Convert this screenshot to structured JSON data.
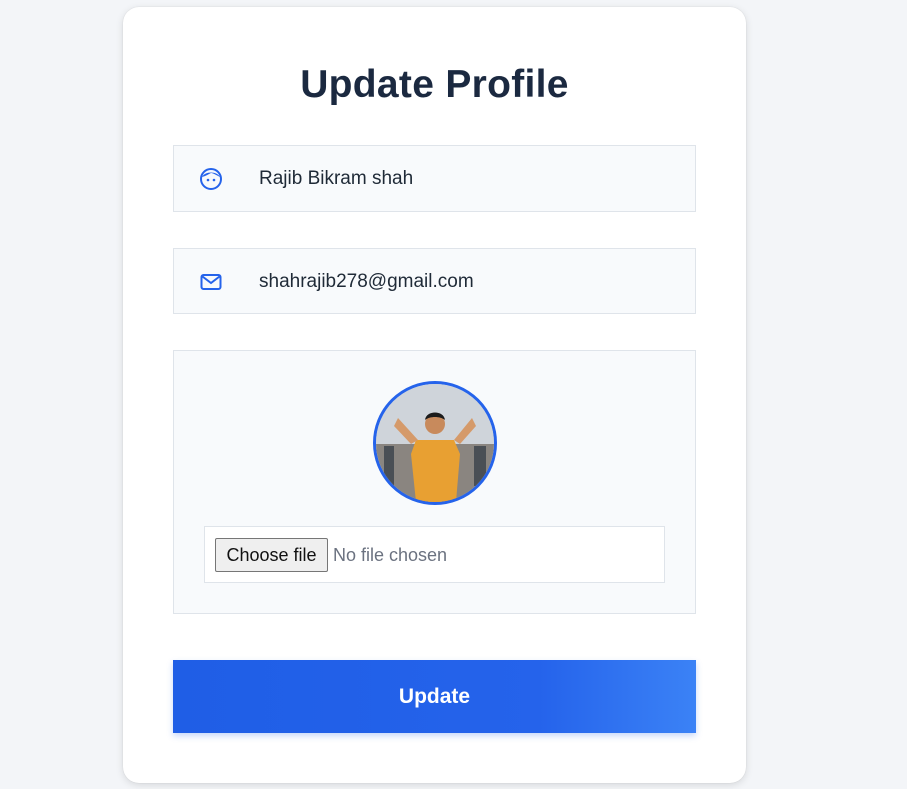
{
  "form": {
    "title": "Update Profile",
    "name_value": "Rajib Bikram shah",
    "email_value": "shahrajib278@gmail.com",
    "file": {
      "button_label": "Choose file",
      "status_text": "No file chosen"
    },
    "submit_label": "Update"
  },
  "icons": {
    "name": "face-icon",
    "email": "mail-icon"
  },
  "colors": {
    "accent": "#2563eb",
    "title": "#1b2940"
  }
}
